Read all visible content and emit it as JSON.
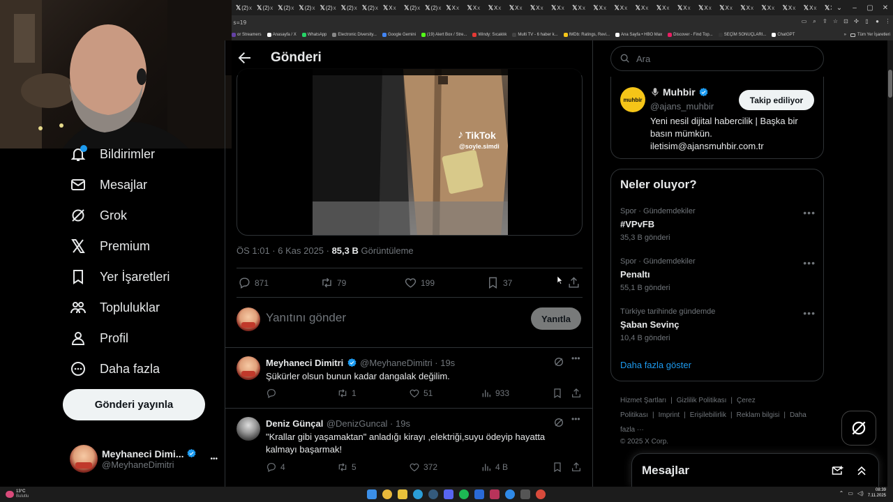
{
  "browser": {
    "tabs": [
      "(2)",
      "(2)",
      "(2)",
      "(2)",
      "(2)",
      "(2)",
      "(2)",
      "X",
      "(2)",
      "(2)",
      "X",
      "X",
      "X",
      "X",
      "X",
      "X",
      "X",
      "X",
      "X",
      "X",
      "X",
      "X",
      "X",
      "X",
      "X",
      "X",
      "X",
      "X",
      "X",
      "X",
      "X"
    ],
    "tab_close": "x",
    "new_tab": "+",
    "url": "s=19",
    "bookmarks": [
      {
        "label": "or Streamers",
        "color": "#6441a5"
      },
      {
        "label": "Anasayfa / X",
        "color": "#ffffff"
      },
      {
        "label": "WhatsApp",
        "color": "#25d366"
      },
      {
        "label": "Electronic Diversity...",
        "color": "#888888"
      },
      {
        "label": "Google Gemini",
        "color": "#4285f4"
      },
      {
        "label": "(19) Alert Box / Stre...",
        "color": "#53fc18"
      },
      {
        "label": "Windy: Sıcaklık",
        "color": "#e53935"
      },
      {
        "label": "Multi TV - 6 haber k...",
        "color": "#444444"
      },
      {
        "label": "IMDb: Ratings, Revi...",
        "color": "#f5c518"
      },
      {
        "label": "Ana Sayfa • HBO Max",
        "color": "#ffffff"
      },
      {
        "label": "Discover - Find Top...",
        "color": "#e91e63"
      },
      {
        "label": "SEÇİM SONUÇLARI...",
        "color": "#333333"
      },
      {
        "label": "ChatGPT",
        "color": "#ffffff"
      }
    ],
    "bookmarks_more": "»",
    "bookmarks_all": "Tüm Yer İşaretleri"
  },
  "nav": {
    "items": [
      {
        "label": "Bildirimler",
        "icon": "bell-icon"
      },
      {
        "label": "Mesajlar",
        "icon": "envelope-icon"
      },
      {
        "label": "Grok",
        "icon": "grok-icon"
      },
      {
        "label": "Premium",
        "icon": "x-logo-icon"
      },
      {
        "label": "Yer İşaretleri",
        "icon": "bookmark-icon"
      },
      {
        "label": "Topluluklar",
        "icon": "communities-icon"
      },
      {
        "label": "Profil",
        "icon": "person-icon"
      },
      {
        "label": "Daha fazla",
        "icon": "more-circle-icon"
      }
    ],
    "post_button": "Gönderi yayınla",
    "account": {
      "name": "Meyhaneci Dimi...",
      "handle": "@MeyhaneDimitri",
      "more": "•••"
    }
  },
  "header": {
    "title": "Gönderi"
  },
  "video": {
    "watermark": "TikTok",
    "watermark_handle": "@soyle.simdi"
  },
  "post_meta": {
    "time": "ÖS 1:01 · 6 Kas 2025 · ",
    "views": "85,3 B",
    "views_label": " Görüntüleme"
  },
  "actions": {
    "replies": "871",
    "reposts": "79",
    "likes": "199",
    "bookmarks": "37"
  },
  "reply_box": {
    "placeholder": "Yanıtını gönder",
    "button": "Yanıtla"
  },
  "replies": [
    {
      "name": "Meyhaneci Dimitri",
      "handle": "@MeyhaneDimitri · 19s",
      "text": "Şükürler olsun bunun kadar dangalak değilim.",
      "replies": "",
      "reposts": "1",
      "likes": "51",
      "views": "933"
    },
    {
      "name": "Deniz Günçal",
      "handle": "@DenizGuncal · 19s",
      "text_line1": "\"Krallar gibi yaşamaktan\" anladığı kirayı ,elektriği,suyu ödeyip hayatta",
      "text_line2": "kalmayı başarmak!",
      "replies": "4",
      "reposts": "5",
      "likes": "372",
      "views": "4 B"
    }
  ],
  "search": {
    "placeholder": "Ara"
  },
  "profile_card": {
    "name": "Muhbir",
    "handle": "@ajans_muhbir",
    "follow_button": "Takip ediliyor",
    "logo_text": "muhbir",
    "logo_color": "#f5c518",
    "bio_line1": "Yeni nesil dijital habercilik | Başka bir",
    "bio_line2": "basın mümkün.",
    "bio_line3": "iletisim@ajansmuhbir.com.tr"
  },
  "trends": {
    "title": "Neler oluyor?",
    "items": [
      {
        "category": "Spor · Gündemdekiler",
        "title": "#VPvFB",
        "count": "35,3 B gönderi"
      },
      {
        "category": "Spor · Gündemdekiler",
        "title": "Penaltı",
        "count": "55,1 B gönderi"
      },
      {
        "category": "Türkiye tarihinde gündemde",
        "title": "Şaban Sevinç",
        "count": "10,4 B gönderi"
      }
    ],
    "more_dots": "•••",
    "show_more": "Daha fazla göster"
  },
  "footer": {
    "links": [
      "Hizmet Şartları",
      "|",
      "Gizlilik Politikası",
      "|",
      "Çerez Politikası",
      "|",
      "Imprint",
      "|",
      "Erişilebilirlik",
      "|",
      "Reklam bilgisi",
      "|",
      "Daha fazla ···"
    ],
    "copyright": "© 2025 X Corp."
  },
  "messages_drawer": {
    "title": "Mesajlar"
  },
  "taskbar": {
    "weather_temp": "13°C",
    "weather_desc": "Bulutlu",
    "time": "08:39",
    "date": "7.11.2025"
  },
  "colors": {
    "accent": "#1d9bf0",
    "bg": "#000000",
    "muted": "#71767b",
    "border": "#2f3336"
  }
}
